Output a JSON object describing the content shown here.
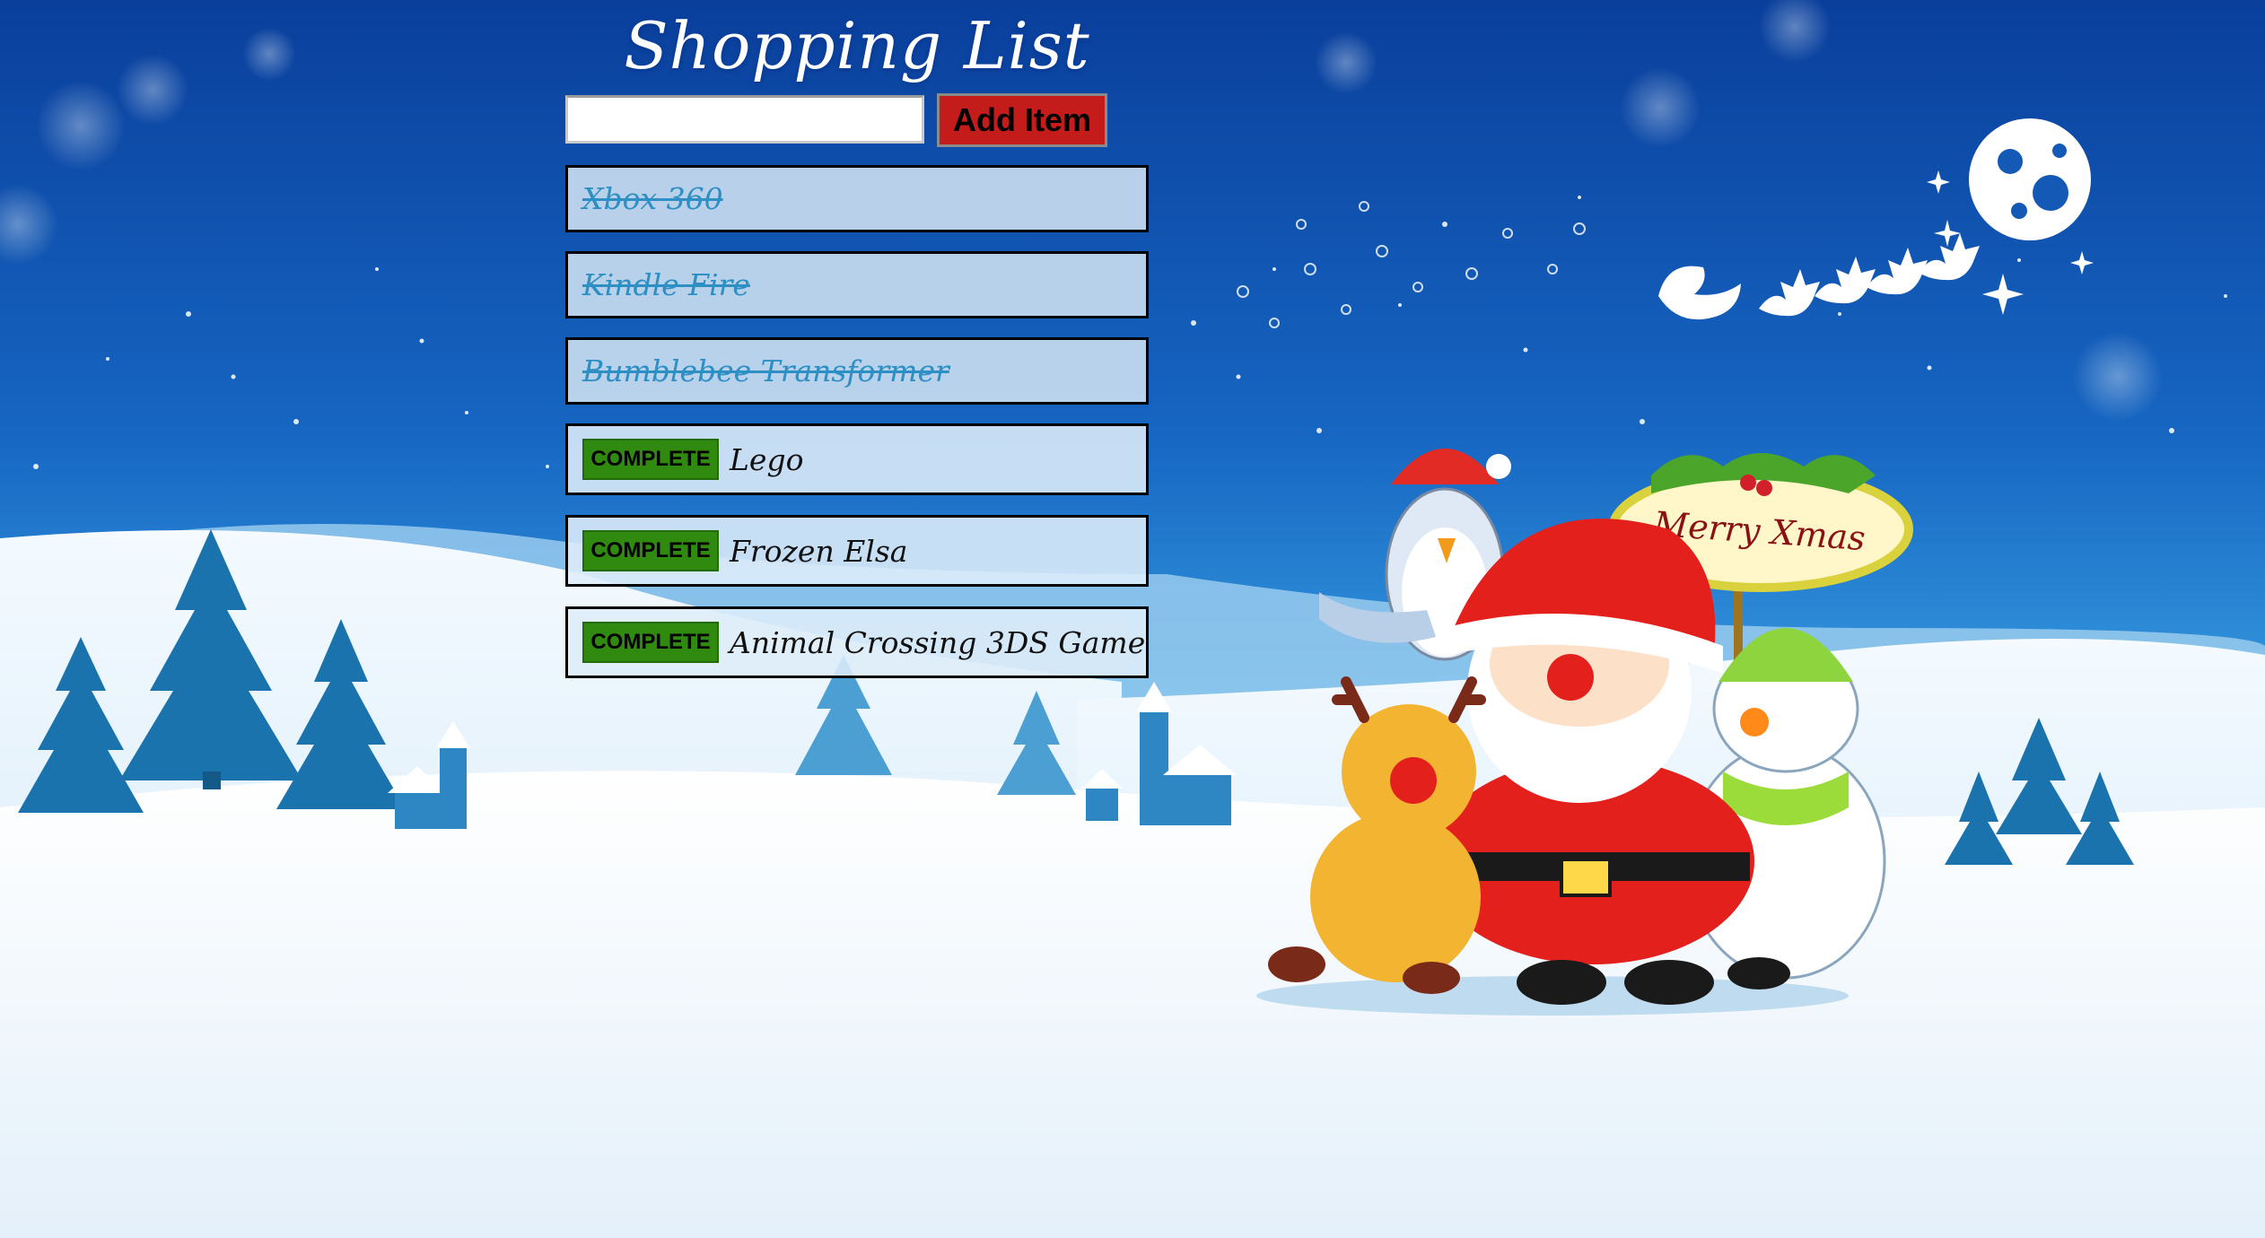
{
  "app": {
    "title": "Shopping List",
    "add_button_label": "Add Item",
    "input_value": "",
    "input_placeholder": ""
  },
  "items": [
    {
      "name": "Xbox 360",
      "completed": true
    },
    {
      "name": "Kindle Fire",
      "completed": true
    },
    {
      "name": "Bumblebee Transformer",
      "completed": true
    },
    {
      "name": "Lego",
      "completed": false,
      "action_label": "COMPLETE"
    },
    {
      "name": "Frozen Elsa",
      "completed": false,
      "action_label": "COMPLETE"
    },
    {
      "name": "Animal Crossing 3DS Game",
      "completed": false,
      "action_label": "COMPLETE"
    }
  ],
  "background": {
    "sign_text": "Merry Xmas",
    "colors": {
      "sky_top": "#0a4aa8",
      "sky_mid": "#1f7fd0",
      "snow": "#eaf4fc",
      "santa_red": "#e3201b",
      "button_red": "#c41b1b",
      "button_green": "#2f8a0f"
    }
  }
}
